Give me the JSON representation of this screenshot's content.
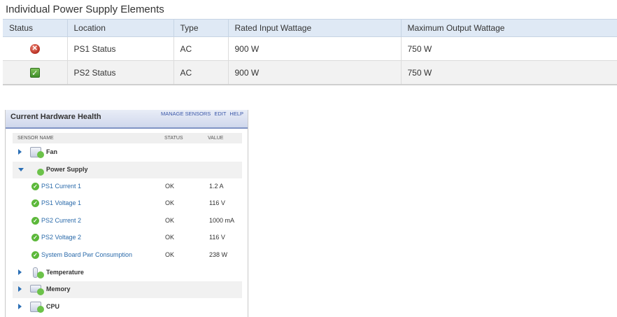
{
  "power_supply": {
    "title": "Individual Power Supply Elements",
    "columns": [
      "Status",
      "Location",
      "Type",
      "Rated Input Wattage",
      "Maximum Output Wattage"
    ],
    "rows": [
      {
        "status": "error",
        "location": "PS1 Status",
        "type": "AC",
        "rated_input": "900 W",
        "max_output": "750 W"
      },
      {
        "status": "ok",
        "location": "PS2 Status",
        "type": "AC",
        "rated_input": "900 W",
        "max_output": "750 W"
      }
    ]
  },
  "hardware_health": {
    "title": "Current Hardware Health",
    "links": [
      "MANAGE SENSORS",
      "EDIT",
      "HELP"
    ],
    "columns": {
      "sensor": "SENSOR NAME",
      "status": "STATUS",
      "value": "VALUE"
    },
    "categories": {
      "fan": "Fan",
      "power_supply": "Power Supply",
      "temperature": "Temperature",
      "memory": "Memory",
      "cpu": "CPU"
    },
    "sensors": [
      {
        "name": "PS1 Current 1",
        "status": "OK",
        "value": "1.2 A"
      },
      {
        "name": "PS1 Voltage 1",
        "status": "OK",
        "value": "116 V"
      },
      {
        "name": "PS2 Current 2",
        "status": "OK",
        "value": "1000 mA"
      },
      {
        "name": "PS2 Voltage 2",
        "status": "OK",
        "value": "116 V"
      },
      {
        "name": "System Board Pwr Consumption",
        "status": "OK",
        "value": "238 W"
      }
    ]
  }
}
